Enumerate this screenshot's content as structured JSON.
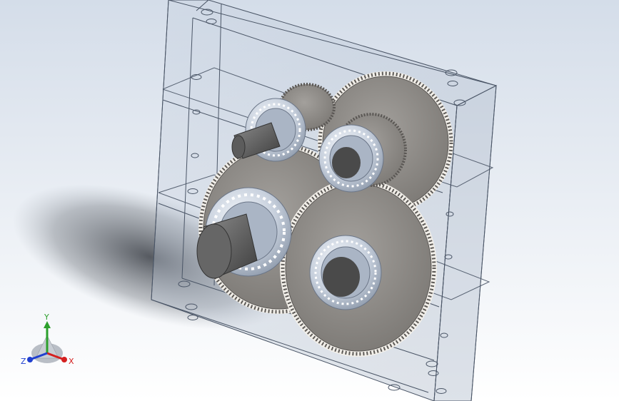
{
  "viewport": {
    "background_top": "#d4dde9",
    "background_bottom": "#ffffff"
  },
  "model": {
    "housing_color": "#8fa0b8",
    "gear_color": "#8a8784",
    "bearing_color": "#cfd8e6",
    "shaft_color": "#6e6e6e"
  },
  "triad": {
    "x_label": "X",
    "y_label": "Y",
    "z_label": "Z",
    "x_color": "#d42020",
    "y_color": "#2ca02c",
    "z_color": "#2040d0"
  }
}
